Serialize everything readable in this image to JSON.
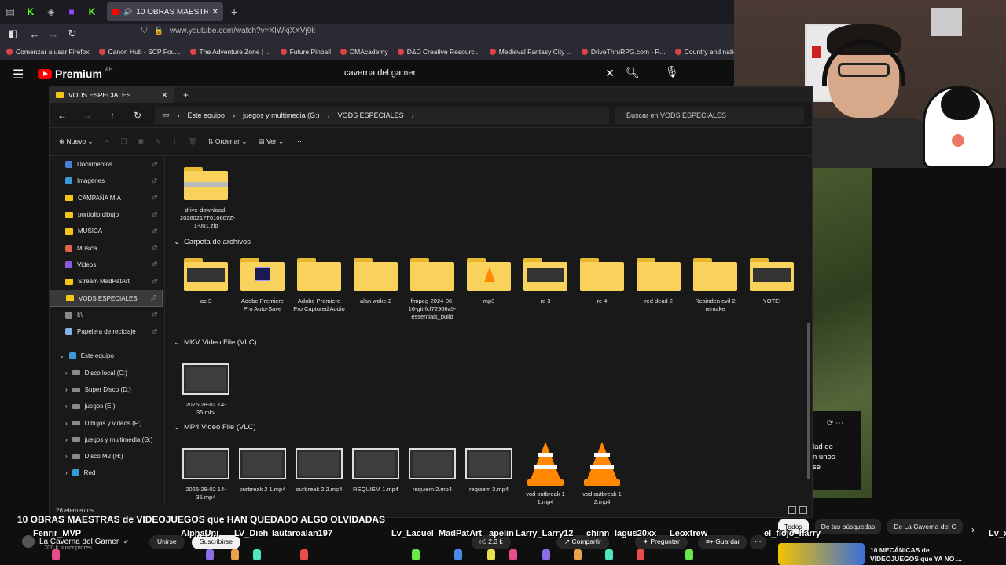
{
  "browser": {
    "tab_title": "10 OBRAS MAESTRAS de V",
    "url": "www.youtube.com/watch?v=XIWkjXXVj9k",
    "bookmarks": [
      "Comenzar a usar Firefox",
      "Canon Hub - SCP Fou...",
      "The Adventure Zone | ...",
      "Future Pinball",
      "DMAcademy",
      "D&D Creative Resourc...",
      "Medieval Fantasy City ...",
      "DriveThruRPG.com - R...",
      "Country and nation na...",
      "D&D Co"
    ]
  },
  "youtube": {
    "logo_text": "Premium",
    "region": "AR",
    "search_value": "caverna del gamer",
    "video_title": "10 OBRAS MAESTRAS de VIDEOJUEGOS que HAN QUEDADO ALGO OLVIDADAS",
    "channel_name": "La Caverna del Gamer",
    "subscribers": "700 k suscriptores",
    "join_label": "Unirse",
    "subscribe_label": "Suscribirse",
    "likes": "2.3 k",
    "share_label": "Compartir",
    "ask_label": "Preguntar",
    "save_label": "Guardar",
    "chips": [
      "Todos",
      "De tus búsquedas",
      "De La Caverna del G"
    ],
    "rec_title_line1": "10 MECÁNICAS de",
    "rec_title_line2": "VIDEOJUEGOS que YA NO ...",
    "overlay_text": [
      "lad de",
      "n unos",
      "se"
    ]
  },
  "stream_chat": {
    "names": [
      "Fenrir_MVP",
      "AlphaUni",
      "LV_Dieh",
      "lautaroalan197",
      "Lv_Lacuel",
      "MadPatArt",
      "apelin",
      "Larry_Larry12",
      "chinn",
      "lagus20xx",
      "Leoxtrew",
      "el_flojo_harry",
      "Lv_x"
    ],
    "sprite_colors": [
      "#e84c8a",
      "#8a6de8",
      "#e8a24c",
      "#4ce8c0",
      "#e84c4c",
      "#6de84c",
      "#4c8ae8",
      "#e8e04c"
    ]
  },
  "explorer": {
    "tab_title": "VODS ESPECIALES",
    "breadcrumb": [
      "Este equipo",
      "juegos y multimedia (G:)",
      "VODS ESPECIALES"
    ],
    "search_placeholder": "Buscar en VODS ESPECIALES",
    "toolbar": {
      "new": "Nuevo",
      "sort": "Ordenar",
      "view": "Ver"
    },
    "sidebar": {
      "quick": [
        {
          "label": "Documentos",
          "icon": "document-icon",
          "color": "#4a7fd4"
        },
        {
          "label": "Imágenes",
          "icon": "image-icon",
          "color": "#3a9ad9"
        },
        {
          "label": "CAMPAÑA MIA",
          "icon": "folder-icon",
          "color": "#f5c518"
        },
        {
          "label": "portfolio dibujo",
          "icon": "folder-icon",
          "color": "#f5c518"
        },
        {
          "label": "MUSICA",
          "icon": "folder-icon",
          "color": "#f5c518"
        },
        {
          "label": "Música",
          "icon": "music-icon",
          "color": "#e0634a"
        },
        {
          "label": "Videos",
          "icon": "video-icon",
          "color": "#8a5cd6"
        },
        {
          "label": "Stream MadPatArt",
          "icon": "folder-icon",
          "color": "#f5c518"
        },
        {
          "label": "VODS ESPECIALES",
          "icon": "folder-icon",
          "color": "#f5c518"
        },
        {
          "label": "I:\\",
          "icon": "drive-icon",
          "color": "#8a8a8a"
        },
        {
          "label": "Papelera de reciclaje",
          "icon": "recycle-bin-icon",
          "color": "#7fb3e0"
        }
      ],
      "this_pc": "Este equipo",
      "drives": [
        "Disco local (C:)",
        "Super Disco (D:)",
        "juegos (E:)",
        "Dibujos y videos (F:)",
        "juegos y multimedia (G:)",
        "Disco M2 (H:)"
      ],
      "network": "Red"
    },
    "zip_item": "drive-download-20260217T010607Z-1-001.zip",
    "groups": {
      "folders": "Carpeta de archivos",
      "mkv": "MKV Video File (VLC)",
      "mp4": "MP4 Video File (VLC)"
    },
    "folders": [
      "ac 3",
      "Adobe Premiere Pro Auto-Save",
      "Adobe Premiere Pro Captured Audio",
      "alan wake 2",
      "ffmpeg-2024-06-16-git-fcf72966a5-essentials_build",
      "mp3",
      "re 3",
      "re 4",
      "red dead 2",
      "Resinden evil 2 remake",
      "YOTEI"
    ],
    "mkv_files": [
      "2026-28-02 14-35.mkv"
    ],
    "mp4_files": [
      "2026-28-02 14-35.mp4",
      "ourbreak 2 1.mp4",
      "ourbreak 2 2.mp4",
      "REQUIEM 1.mp4",
      "requiem 2.mp4",
      "requiem 3.mp4",
      "vod outbreak 1 1.mp4",
      "vod outbreak 1 2.mp4"
    ],
    "status": "26 elementos"
  }
}
